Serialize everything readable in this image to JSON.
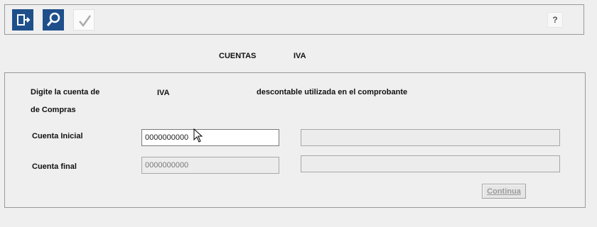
{
  "toolbar": {
    "buttons": [
      {
        "icon": "exit-door-icon"
      },
      {
        "icon": "search-icon"
      },
      {
        "icon": "checkmark-icon"
      }
    ],
    "help_label": "?"
  },
  "header": {
    "title_left": "CUENTAS",
    "title_right": "IVA"
  },
  "form": {
    "prompt_line1_a": "Digite la cuenta de",
    "prompt_line1_b": "IVA",
    "prompt_line1_c": "descontable utilizada en el comprobante",
    "prompt_line2": "de Compras",
    "cuenta_inicial_label": "Cuenta Inicial",
    "cuenta_inicial_value": "0000000000",
    "cuenta_final_label": "Cuenta final",
    "cuenta_final_value": "0000000000",
    "continue_label": "Continua"
  },
  "colors": {
    "toolbar_button_blue": "#1f4f8a",
    "background": "#efefef"
  }
}
